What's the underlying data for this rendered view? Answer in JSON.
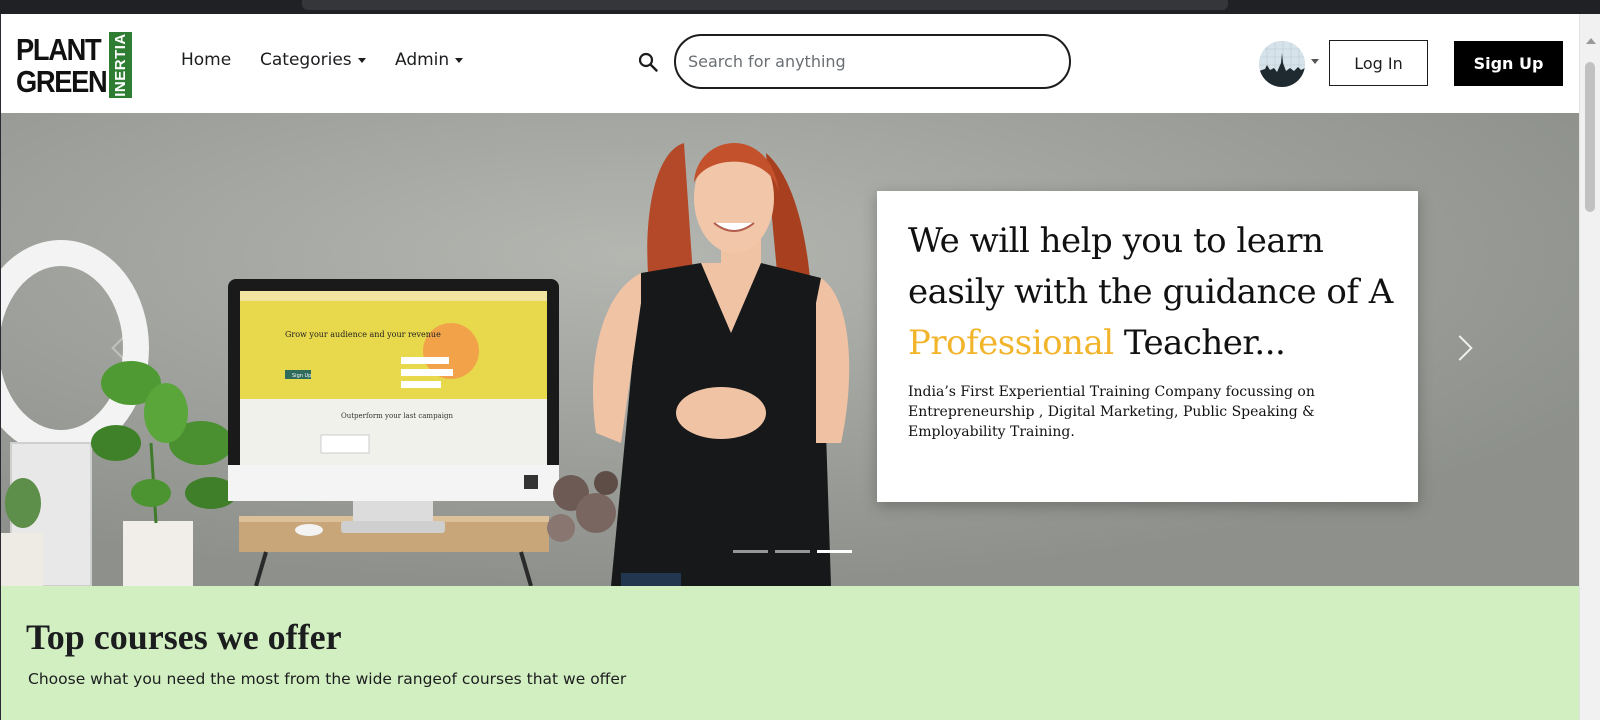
{
  "brand": {
    "logo_line1": "PLANT",
    "logo_line2": "GREEN",
    "logo_vertical": "INERTIA",
    "logo_green": "#2e7d32"
  },
  "nav": {
    "items": [
      {
        "label": "Home",
        "has_dropdown": false
      },
      {
        "label": "Categories",
        "has_dropdown": true
      },
      {
        "label": "Admin",
        "has_dropdown": true
      }
    ]
  },
  "search": {
    "placeholder": "Search for anything",
    "value": "",
    "icon": "search-icon"
  },
  "auth": {
    "login_label": "Log In",
    "signup_label": "Sign Up"
  },
  "hero": {
    "heading_before": "We will help you to learn easily with the guidance of A ",
    "heading_accent": "Professional",
    "heading_after": " Teacher...",
    "accent_color": "#f2b42a",
    "subtext": "India’s First Experiential Training Company focussing on Entrepreneurship , Digital Marketing, Public Speaking & Employability Training.",
    "monitor": {
      "headline": "Grow your audience and your revenue",
      "cta": "Sign Up",
      "footer_text": "Outperform your last campaign"
    },
    "slides": [
      {
        "active": false
      },
      {
        "active": false
      },
      {
        "active": true
      }
    ]
  },
  "courses": {
    "title": "Top courses we offer",
    "subtitle": "Choose what you need the most from the wide rangeof courses that we offer"
  }
}
